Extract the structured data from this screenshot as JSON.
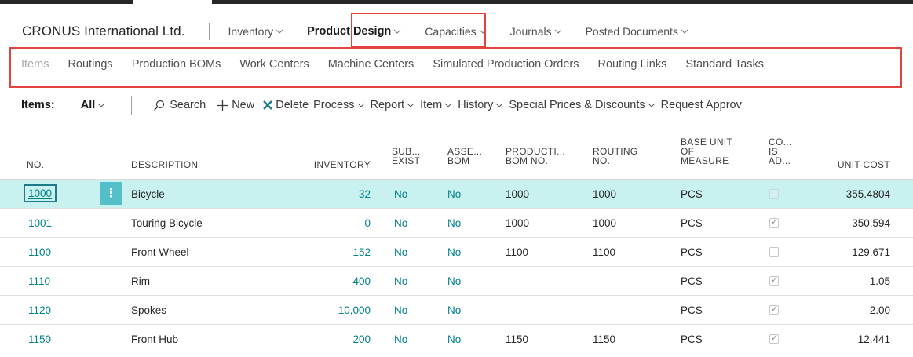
{
  "header": {
    "company": "CRONUS International Ltd.",
    "menu": [
      "Inventory",
      "Product Design",
      "Capacities",
      "Journals",
      "Posted Documents"
    ],
    "active_menu": "Product Design"
  },
  "subnav": {
    "items": [
      "Items",
      "Routings",
      "Production BOMs",
      "Work Centers",
      "Machine Centers",
      "Simulated Production Orders",
      "Routing Links",
      "Standard Tasks"
    ]
  },
  "actionbar": {
    "title": "Items:",
    "filter": "All",
    "search": "Search",
    "new": "New",
    "delete": "Delete",
    "process": "Process",
    "report": "Report",
    "item": "Item",
    "history": "History",
    "special": "Special Prices & Discounts",
    "request": "Request Approv"
  },
  "table": {
    "headers": {
      "no": "NO.",
      "description": "DESCRIPTION",
      "inventory": "INVENTORY",
      "sub1": "SUB...",
      "sub2": "EXIST",
      "asse1": "ASSE...",
      "asse2": "BOM",
      "prod1": "PRODUCTI...",
      "prod2": "BOM NO.",
      "rout1": "ROUTING",
      "rout2": "NO.",
      "base1": "BASE UNIT",
      "base2": "OF",
      "base3": "MEASURE",
      "co1": "CO...",
      "co2": "IS",
      "co3": "AD...",
      "unitcost": "UNIT COST"
    },
    "rows": [
      {
        "no": "1000",
        "description": "Bicycle",
        "inventory": "32",
        "sub": "No",
        "asm": "No",
        "bom": "1000",
        "routing": "1000",
        "uom": "PCS",
        "cost_adj": false,
        "unit_cost": "355.4804"
      },
      {
        "no": "1001",
        "description": "Touring Bicycle",
        "inventory": "0",
        "sub": "No",
        "asm": "No",
        "bom": "1000",
        "routing": "1000",
        "uom": "PCS",
        "cost_adj": true,
        "unit_cost": "350.594"
      },
      {
        "no": "1100",
        "description": "Front Wheel",
        "inventory": "152",
        "sub": "No",
        "asm": "No",
        "bom": "1100",
        "routing": "1100",
        "uom": "PCS",
        "cost_adj": false,
        "unit_cost": "129.671"
      },
      {
        "no": "1110",
        "description": "Rim",
        "inventory": "400",
        "sub": "No",
        "asm": "No",
        "bom": "",
        "routing": "",
        "uom": "PCS",
        "cost_adj": true,
        "unit_cost": "1.05"
      },
      {
        "no": "1120",
        "description": "Spokes",
        "inventory": "10,000",
        "sub": "No",
        "asm": "No",
        "bom": "",
        "routing": "",
        "uom": "PCS",
        "cost_adj": true,
        "unit_cost": "2.00"
      },
      {
        "no": "1150",
        "description": "Front Hub",
        "inventory": "200",
        "sub": "No",
        "asm": "No",
        "bom": "1150",
        "routing": "1150",
        "uom": "PCS",
        "cost_adj": true,
        "unit_cost": "12.441"
      }
    ]
  },
  "colors": {
    "accent": "#00818a",
    "selected_row": "#c9f1ef",
    "highlight_box": "#e0443c"
  }
}
